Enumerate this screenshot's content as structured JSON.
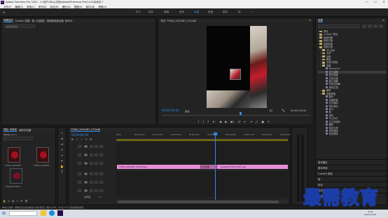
{
  "titlebar": {
    "app_icon": "Pr",
    "title": "Adobe Premiere Pro 2020 - C:\\用户\\Ditu\\文档\\Adobe\\Premiere Pro\\14.0\\未命名 *",
    "minimize": "—",
    "maximize": "☐",
    "close": "✕"
  },
  "menubar": [
    "文件(F)",
    "编辑(E)",
    "剪辑(C)",
    "序列(S)",
    "标记(M)",
    "图形(G)",
    "视图(V)",
    "窗口(W)",
    "帮助(H)"
  ],
  "workspaces": {
    "home_icon": "home-icon",
    "tabs": [
      "学习",
      "组件",
      "编辑",
      "颜色",
      "效果",
      "音频",
      "图形",
      "库"
    ],
    "active": "效果",
    "overflow": "»"
  },
  "source_panel": {
    "tabs": [
      "效果控件",
      "Lumetri 范围",
      "源: (无剪辑)",
      "音频剪辑混合器: 序列01"
    ],
    "placeholder": "(未选择剪辑)"
  },
  "program_monitor": {
    "title": "节目: TTMIG_2021087_075448",
    "menu": "≡",
    "timecode_left": "00:00:00:00",
    "fit": "适合",
    "scale": "1/2",
    "timecode_right": "00:00:10:00",
    "controls": [
      "{",
      "|",
      "}",
      "|←",
      "◀",
      "▶",
      "▶|",
      "→|",
      "⇤",
      "⇥",
      "⤢",
      "▣",
      "+"
    ]
  },
  "project_panel": {
    "tabs": [
      "项目: 未命名",
      "媒体浏览器"
    ],
    "menu": "»",
    "project_file": "未命名.prproj",
    "items_count": "1 项已选择, 共 3 项",
    "items": [
      {
        "name": "TTMIG_2021087...",
        "dur": "5:00"
      },
      {
        "name": "TTMIG_2021087...",
        "dur": "5:00"
      },
      {
        "name": "image2021087...",
        "dur": "5:00"
      }
    ]
  },
  "timeline": {
    "title": "TTMIG_2021087_075448",
    "menu": "≡",
    "timecode": "00:00:00:00",
    "ruler": [
      "00:00",
      "00:00:01:00",
      "00:00:02:00",
      "00:00:03:00",
      "00:00:04:00",
      "00:00:05:00",
      "00:00:06:00",
      "00:00:07:00",
      "00:00:08:00",
      "00:00:09:00"
    ],
    "video_tracks": [
      "V3",
      "V2",
      "V1"
    ],
    "audio_tracks": [
      "A1",
      "A2",
      "A3"
    ],
    "master": "主声道",
    "master_val": "0.0",
    "clip_a": "TTMIG_2021087_075448.jpg",
    "clip_transition": "交叉溶解",
    "clip_b": "image2021087223217.jpg"
  },
  "effects_panel": {
    "title": "效果",
    "menu": "≡",
    "search_placeholder": "",
    "items": [
      {
        "label": "预设",
        "indent": 1,
        "folder": true
      },
      {
        "label": "Lumetri 预设",
        "indent": 1,
        "folder": true
      },
      {
        "label": "音频效果",
        "indent": 1,
        "folder": true
      },
      {
        "label": "音频过渡",
        "indent": 1,
        "folder": true
      },
      {
        "label": "视频效果",
        "indent": 1,
        "folder": true
      },
      {
        "label": "视频过渡",
        "indent": 1,
        "folder": true
      },
      {
        "label": "3D 运动",
        "indent": 2,
        "folder": true
      },
      {
        "label": "内滑",
        "indent": 2,
        "folder": true
      },
      {
        "label": "划像",
        "indent": 2,
        "folder": true
      },
      {
        "label": "擦除",
        "indent": 2,
        "folder": true
      },
      {
        "label": "沉浸式视频",
        "indent": 2,
        "folder": true
      },
      {
        "label": "溶解",
        "indent": 2,
        "folder": true
      },
      {
        "label": "MorphCut",
        "indent": 3,
        "folder": false
      },
      {
        "label": "交叉溶解",
        "indent": 3,
        "folder": false
      },
      {
        "label": "叠加溶解",
        "indent": 3,
        "folder": false
      },
      {
        "label": "白场过渡",
        "indent": 3,
        "folder": false
      },
      {
        "label": "胶片溶解",
        "indent": 3,
        "folder": false
      },
      {
        "label": "非叠加溶解",
        "indent": 3,
        "folder": false
      },
      {
        "label": "黑场过渡",
        "indent": 3,
        "folder": false
      },
      {
        "label": "缩放",
        "indent": 2,
        "folder": true
      },
      {
        "label": "页面剥落",
        "indent": 2,
        "folder": true
      },
      {
        "label": "翻页",
        "indent": 3,
        "folder": false
      },
      {
        "label": "页面剥落",
        "indent": 3,
        "folder": false
      },
      {
        "label": "交叉缩放",
        "indent": 3,
        "folder": false
      },
      {
        "label": "带状滑动",
        "indent": 3,
        "folder": false
      },
      {
        "label": "拆分",
        "indent": 3,
        "folder": false
      },
      {
        "label": "推",
        "indent": 3,
        "folder": false
      },
      {
        "label": "滑动",
        "indent": 3,
        "folder": false
      },
      {
        "label": "中心拆分",
        "indent": 3,
        "folder": false
      },
      {
        "label": "立方体旋转",
        "indent": 3,
        "folder": false
      },
      {
        "label": "翻转",
        "indent": 3,
        "folder": false
      },
      {
        "label": "带状内滑",
        "indent": 3,
        "folder": false
      },
      {
        "label": "带状擦除",
        "indent": 3,
        "folder": false
      },
      {
        "label": "渐变擦除",
        "indent": 3,
        "folder": false
      }
    ],
    "bottom_sections": [
      "基本图形",
      "基本声音",
      "Lumetri 颜色",
      "库",
      "标记",
      "历史记录",
      "信息"
    ]
  },
  "status_text": "单击以选择，或单击空白处并拖动以进行框选。使用 Shift、Alt 和 Ctrl 可获得其他选项。",
  "taskbar": {
    "time": "9:18",
    "date": "2021/11/12"
  },
  "watermark": "最需教育",
  "colors": {
    "accent": "#2d8ceb",
    "clip_pink": "#e68fd8",
    "transition": "#b86aa4",
    "playhead": "#2d8ceb"
  }
}
